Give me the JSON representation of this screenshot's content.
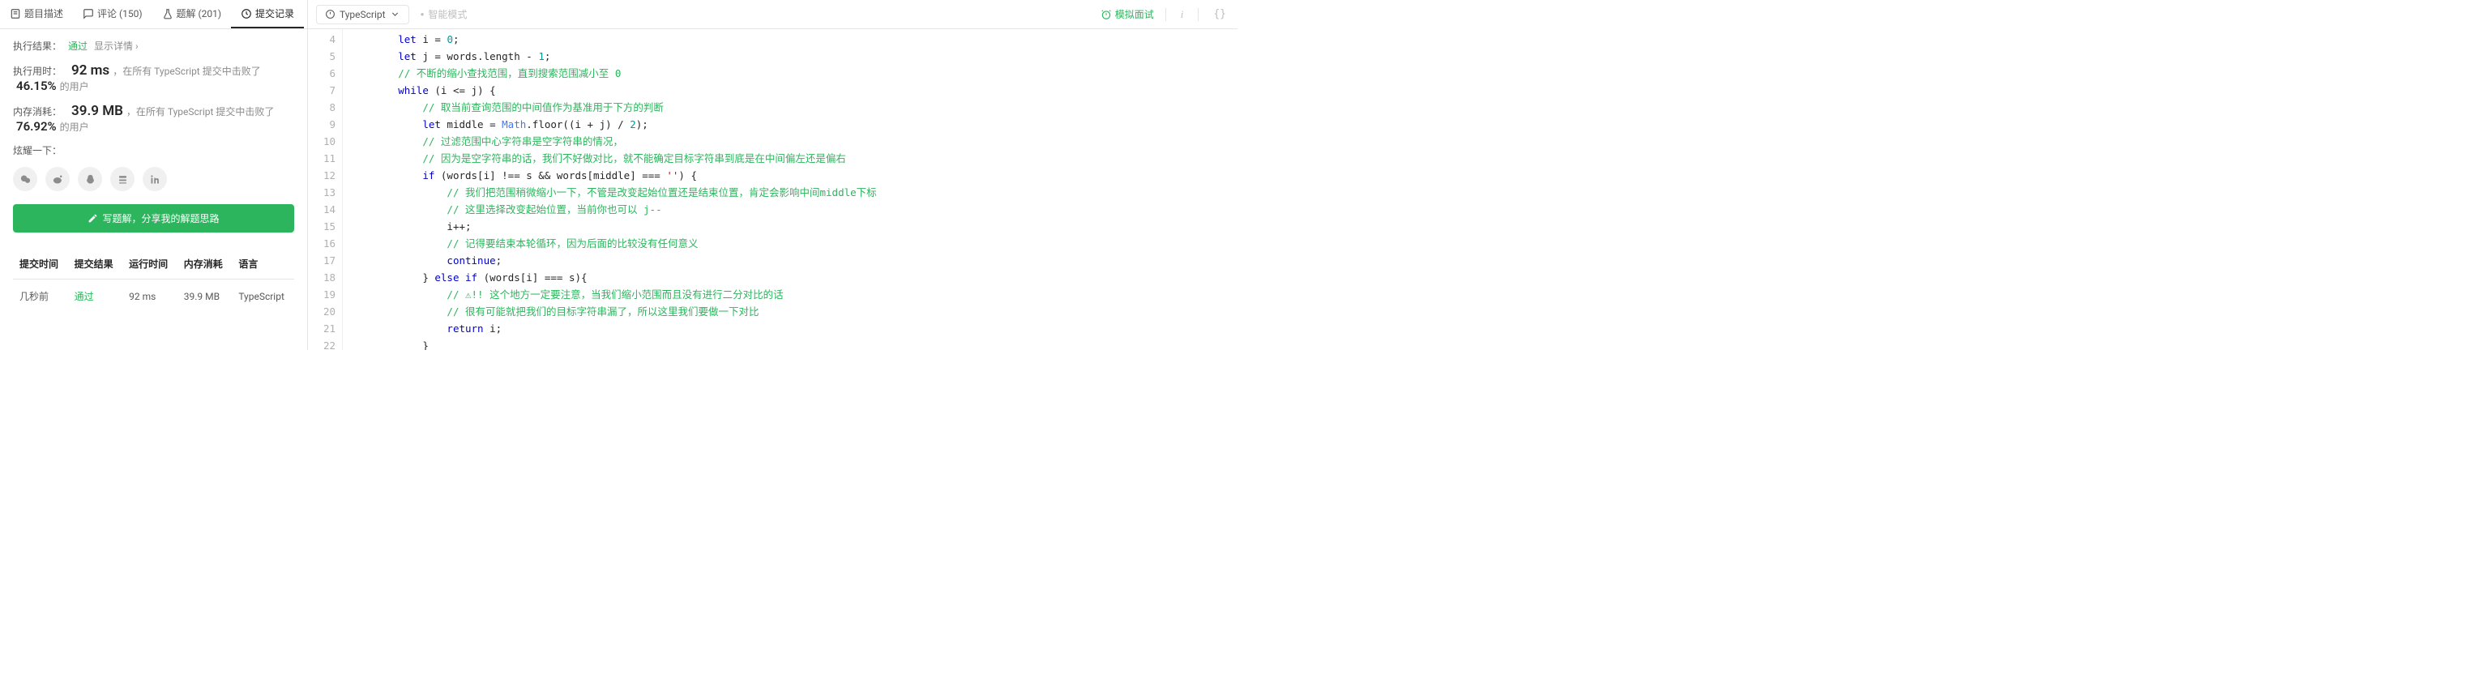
{
  "tabs": {
    "desc": "题目描述",
    "comments": "评论 (150)",
    "solutions": "题解 (201)",
    "submissions": "提交记录"
  },
  "result": {
    "label": "执行结果：",
    "status": "通过",
    "show_detail": "显示详情 ›"
  },
  "runtime": {
    "label": "执行用时：",
    "value": "92 ms",
    "text1": "，在所有 TypeScript 提交中击败了",
    "pct": "46.15%",
    "text2": " 的用户"
  },
  "memory": {
    "label": "内存消耗：",
    "value": "39.9 MB",
    "text1": "，在所有 TypeScript 提交中击败了",
    "pct": "76.92%",
    "text2": " 的用户"
  },
  "brag_label": "炫耀一下：",
  "write_btn": "写题解，分享我的解题思路",
  "table": {
    "h_time": "提交时间",
    "h_result": "提交结果",
    "h_runtime": "运行时间",
    "h_memory": "内存消耗",
    "h_lang": "语言",
    "rows": [
      {
        "time": "几秒前",
        "result": "通过",
        "runtime": "92 ms",
        "memory": "39.9 MB",
        "lang": "TypeScript"
      }
    ]
  },
  "editor": {
    "language": "TypeScript",
    "smart_mode": "智能模式",
    "mock_interview": "模拟面试"
  },
  "code_lines": [
    {
      "n": 4,
      "indent": 2,
      "tokens": [
        [
          "kw",
          "let"
        ],
        [
          "",
          " i = "
        ],
        [
          "num",
          "0"
        ],
        [
          "",
          ";"
        ]
      ]
    },
    {
      "n": 5,
      "indent": 2,
      "tokens": [
        [
          "kw",
          "let"
        ],
        [
          "",
          " j = words.length - "
        ],
        [
          "num",
          "1"
        ],
        [
          "",
          ";"
        ]
      ]
    },
    {
      "n": 6,
      "indent": 2,
      "tokens": [
        [
          "cm",
          "// 不断的缩小查找范围，直到搜索范围减小至 0"
        ]
      ]
    },
    {
      "n": 7,
      "indent": 2,
      "tokens": [
        [
          "kw",
          "while"
        ],
        [
          "",
          " (i <= j) {"
        ]
      ]
    },
    {
      "n": 8,
      "indent": 3,
      "tokens": [
        [
          "cm",
          "// 取当前查询范围的中间值作为基准用于下方的判断"
        ]
      ]
    },
    {
      "n": 9,
      "indent": 3,
      "tokens": [
        [
          "kw",
          "let"
        ],
        [
          "",
          " middle = "
        ],
        [
          "fn",
          "Math"
        ],
        [
          "",
          ".floor((i + j) / "
        ],
        [
          "num",
          "2"
        ],
        [
          "",
          ");"
        ]
      ]
    },
    {
      "n": 10,
      "indent": 3,
      "tokens": [
        [
          "cm",
          "// 过滤范围中心字符串是空字符串的情况，"
        ]
      ]
    },
    {
      "n": 11,
      "indent": 3,
      "tokens": [
        [
          "cm",
          "// 因为是空字符串的话，我们不好做对比，就不能确定目标字符串到底是在中间偏左还是偏右"
        ]
      ]
    },
    {
      "n": 12,
      "indent": 3,
      "tokens": [
        [
          "kw",
          "if"
        ],
        [
          "",
          " (words[i] !== s && words[middle] === "
        ],
        [
          "st",
          "''"
        ],
        [
          "",
          ") {"
        ]
      ]
    },
    {
      "n": 13,
      "indent": 4,
      "tokens": [
        [
          "cm",
          "// 我们把范围稍微缩小一下，不管是改变起始位置还是结束位置，肯定会影响中间middle下标"
        ]
      ]
    },
    {
      "n": 14,
      "indent": 4,
      "tokens": [
        [
          "cm",
          "// 这里选择改变起始位置，当前你也可以 j--"
        ]
      ]
    },
    {
      "n": 15,
      "indent": 4,
      "tokens": [
        [
          "",
          "i++;"
        ]
      ]
    },
    {
      "n": 16,
      "indent": 4,
      "tokens": [
        [
          "cm",
          "// 记得要结束本轮循环，因为后面的比较没有任何意义"
        ]
      ]
    },
    {
      "n": 17,
      "indent": 4,
      "tokens": [
        [
          "kw",
          "continue"
        ],
        [
          "",
          ";"
        ]
      ]
    },
    {
      "n": 18,
      "indent": 3,
      "tokens": [
        [
          "",
          "} "
        ],
        [
          "kw",
          "else if"
        ],
        [
          "",
          " (words[i] === s){"
        ]
      ]
    },
    {
      "n": 19,
      "indent": 4,
      "tokens": [
        [
          "cm",
          "// ⚠!! 这个地方一定要注意，当我们缩小范围而且没有进行二分对比的话"
        ]
      ]
    },
    {
      "n": 20,
      "indent": 4,
      "tokens": [
        [
          "cm",
          "// 很有可能就把我们的目标字符串漏了，所以这里我们要做一下对比"
        ]
      ]
    },
    {
      "n": 21,
      "indent": 4,
      "tokens": [
        [
          "kw",
          "return"
        ],
        [
          "",
          " i;"
        ]
      ]
    },
    {
      "n": 22,
      "indent": 3,
      "tokens": [
        [
          "",
          "}"
        ]
      ]
    }
  ]
}
